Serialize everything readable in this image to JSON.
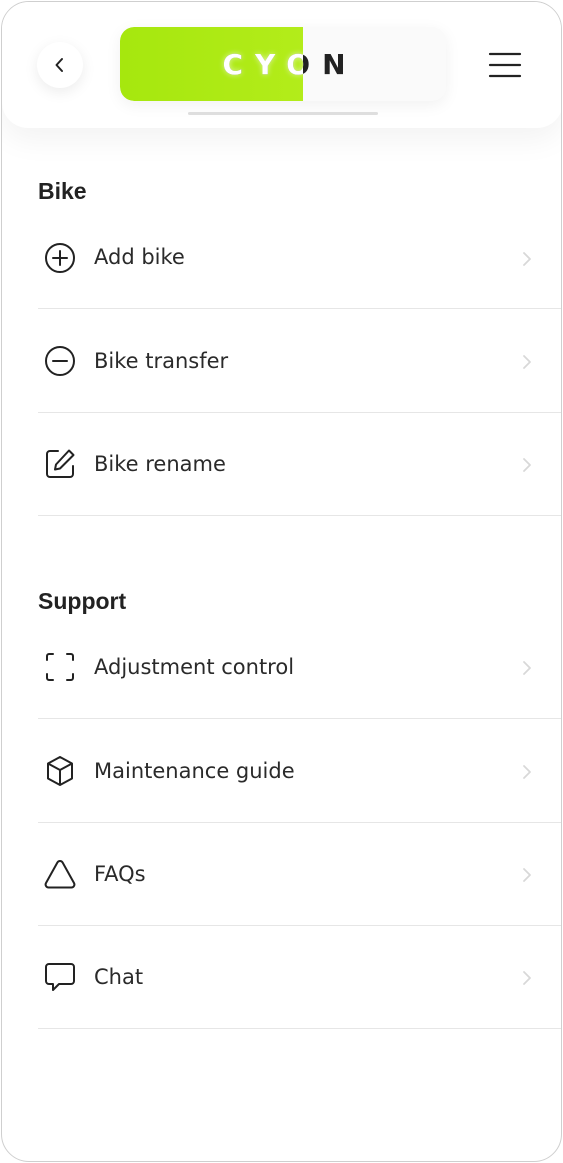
{
  "header": {
    "back_icon": "chevron-left-icon",
    "logo_text": "CYON",
    "logo_fill_fraction": 0.56,
    "accent_color": "#a6e70e",
    "menu_icon": "hamburger-menu-icon"
  },
  "sections": [
    {
      "title": "Bike",
      "items": [
        {
          "label": "Add bike",
          "icon": "plus-circle-icon"
        },
        {
          "label": "Bike transfer",
          "icon": "minus-circle-icon"
        },
        {
          "label": "Bike rename",
          "icon": "edit-icon"
        }
      ]
    },
    {
      "title": "Support",
      "items": [
        {
          "label": "Adjustment control",
          "icon": "focus-frame-icon"
        },
        {
          "label": "Maintenance guide",
          "icon": "cube-icon"
        },
        {
          "label": "FAQs",
          "icon": "triangle-icon"
        },
        {
          "label": "Chat",
          "icon": "chat-bubble-icon"
        }
      ]
    }
  ]
}
